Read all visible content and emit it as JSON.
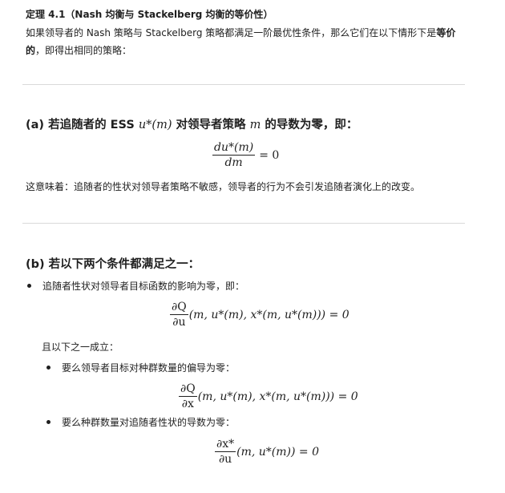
{
  "theorem": {
    "title": "定理 4.1（Nash 均衡与 Stackelberg 均衡的等价性）",
    "intro_text": "如果领导者的 Nash 策略与 Stackelberg 策略都满足一阶最优性条件，那么它们在以下情形下是",
    "intro_bold_1": "等价",
    "intro_bold_2": "的",
    "intro_end": "，即得出相同的策略："
  },
  "section_a": {
    "heading_prefix": "(a) 若追随者的 ESS ",
    "heading_math": "u*(m)",
    "heading_mid": " 对领导者策略 ",
    "heading_math2": "m",
    "heading_suffix": " 的导数为零，即：",
    "eq_num": "du*(m)",
    "eq_den": "dm",
    "eq_rhs": "= 0",
    "meaning": "这意味着：追随者的性状对领导者策略不敏感，领导者的行为不会引发追随者演化上的改变。"
  },
  "section_b": {
    "heading": "(b) 若以下两个条件都满足之一：",
    "bullet1": "追随者性状对领导者目标函数的影响为零，即：",
    "eq1_num": "∂Q",
    "eq1_den": "∂u",
    "eq1_rest": "(m, u*(m), x*(m, u*(m))) = 0",
    "and_text": "且以下之一成立：",
    "sub1": "要么领导者目标对种群数量的偏导为零：",
    "eq2_num": "∂Q",
    "eq2_den": "∂x",
    "eq2_rest": "(m, u*(m), x*(m, u*(m))) = 0",
    "sub2": "要么种群数量对追随者性状的导数为零：",
    "eq3_num": "∂x*",
    "eq3_den": "∂u",
    "eq3_rest": "(m, u*(m)) = 0"
  }
}
